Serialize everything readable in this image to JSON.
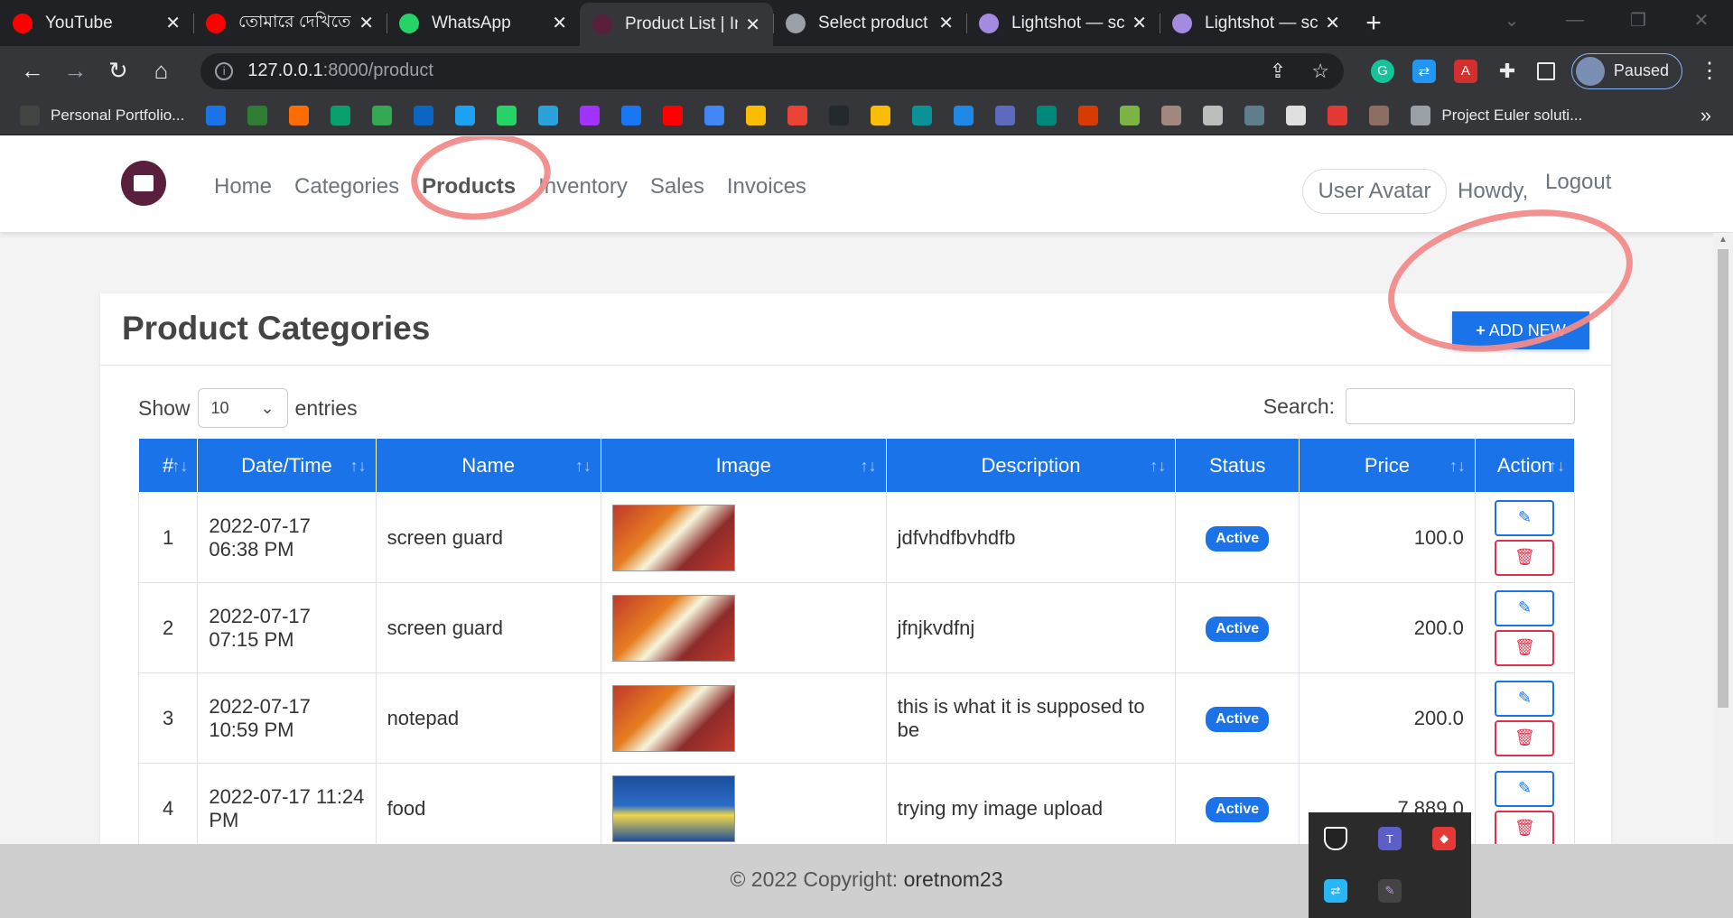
{
  "browser": {
    "tabs": [
      {
        "title": "YouTube",
        "icon": "youtube-icon",
        "color": "#ff0000",
        "active": false
      },
      {
        "title": "তোমারে দেখিতে",
        "icon": "youtube-icon",
        "color": "#ff0000",
        "active": false
      },
      {
        "title": "WhatsApp",
        "icon": "whatsapp-icon",
        "color": "#25d366",
        "active": false
      },
      {
        "title": "Product List | In",
        "icon": "app-icon",
        "color": "#5a1f3d",
        "active": true
      },
      {
        "title": "Select product",
        "icon": "globe-icon",
        "color": "#9aa0a6",
        "active": false
      },
      {
        "title": "Lightshot — sc",
        "icon": "feather-icon",
        "color": "#a58be0",
        "active": false
      },
      {
        "title": "Lightshot — sc",
        "icon": "feather-icon",
        "color": "#a58be0",
        "active": false
      }
    ],
    "url_host": "127.0.0.1",
    "url_path": ":8000/product",
    "profile_label": "Paused",
    "bookmarks": [
      {
        "label": "Personal Portfolio...",
        "icon": "portfolio-icon",
        "color": "#444"
      },
      {
        "label": "",
        "icon": "wifi-icon",
        "color": "#1a73e8"
      },
      {
        "label": "",
        "icon": "leaf-icon",
        "color": "#2e7d32"
      },
      {
        "label": "",
        "icon": "chart-icon",
        "color": "#ff6d00"
      },
      {
        "label": "",
        "icon": "cb-icon",
        "color": "#0aa06e"
      },
      {
        "label": "",
        "icon": "maps-icon",
        "color": "#34a853"
      },
      {
        "label": "",
        "icon": "linkedin-icon",
        "color": "#0a66c2"
      },
      {
        "label": "",
        "icon": "twitter-icon",
        "color": "#1da1f2"
      },
      {
        "label": "",
        "icon": "whatsapp-icon",
        "color": "#25d366"
      },
      {
        "label": "",
        "icon": "telegram-icon",
        "color": "#2aa1da"
      },
      {
        "label": "",
        "icon": "messenger-icon",
        "color": "#a033ff"
      },
      {
        "label": "",
        "icon": "facebook-icon",
        "color": "#1877f2"
      },
      {
        "label": "",
        "icon": "youtube-icon",
        "color": "#ff0000"
      },
      {
        "label": "",
        "icon": "translate-icon",
        "color": "#4285f4"
      },
      {
        "label": "",
        "icon": "drive-icon",
        "color": "#fbbc04"
      },
      {
        "label": "",
        "icon": "gmail-icon",
        "color": "#ea4335"
      },
      {
        "label": "",
        "icon": "github-icon",
        "color": "#24292e"
      },
      {
        "label": "",
        "icon": "classroom-icon",
        "color": "#fbbc04"
      },
      {
        "label": "",
        "icon": "code-icon",
        "color": "#0a9396"
      },
      {
        "label": "",
        "icon": "arrow-icon",
        "color": "#1e88e5"
      },
      {
        "label": "",
        "icon": "analytics-icon",
        "color": "#5c6bc0"
      },
      {
        "label": "",
        "icon": "meet-icon",
        "color": "#00897b"
      },
      {
        "label": "",
        "icon": "office-icon",
        "color": "#d83b01"
      },
      {
        "label": "",
        "icon": "photos-icon",
        "color": "#7cb342"
      },
      {
        "label": "",
        "icon": "library-icon",
        "color": "#a1887f"
      },
      {
        "label": "",
        "icon": "pen-icon",
        "color": "#bdbdbd"
      },
      {
        "label": "",
        "icon": "s-icon",
        "color": "#607d8b"
      },
      {
        "label": "",
        "icon": "doc-icon",
        "color": "#e0e0e0"
      },
      {
        "label": "",
        "icon": "c-icon",
        "color": "#e53935"
      },
      {
        "label": "",
        "icon": "pe-icon",
        "color": "#8d6e63"
      },
      {
        "label": "Project Euler soluti...",
        "icon": "globe-icon",
        "color": "#9aa0a6"
      }
    ]
  },
  "site": {
    "nav": [
      "Home",
      "Categories",
      "Products",
      "Inventory",
      "Sales",
      "Invoices"
    ],
    "active_nav": "Products",
    "avatar_alt": "User Avatar",
    "howdy": "Howdy,",
    "logout": "Logout"
  },
  "card": {
    "title": "Product Categories",
    "add_new": "ADD NEW",
    "show_label": "Show",
    "page_size": "10",
    "entries_label": "entries",
    "search_label": "Search:"
  },
  "table": {
    "columns": [
      "#",
      "Date/Time",
      "Name",
      "Image",
      "Description",
      "Status",
      "Price",
      "Action"
    ],
    "rows": [
      {
        "num": "1",
        "datetime": "2022-07-17 06:38 PM",
        "name": "screen guard",
        "image": "cartoon",
        "description": "jdfvhdfbvhdfb",
        "status": "Active",
        "price": "100.0"
      },
      {
        "num": "2",
        "datetime": "2022-07-17 07:15 PM",
        "name": "screen guard",
        "image": "cartoon",
        "description": "jfnjkvdfnj",
        "status": "Active",
        "price": "200.0"
      },
      {
        "num": "3",
        "datetime": "2022-07-17 10:59 PM",
        "name": "notepad",
        "image": "cartoon",
        "description": "this is what it is supposed to be",
        "status": "Active",
        "price": "200.0"
      },
      {
        "num": "4",
        "datetime": "2022-07-17 11:24 PM",
        "name": "food",
        "image": "photo",
        "description": "trying my image upload",
        "status": "Active",
        "price": "7,889.0"
      }
    ]
  },
  "footer": {
    "prefix": "© 2022 Copyright:",
    "owner": "oretnom23"
  }
}
